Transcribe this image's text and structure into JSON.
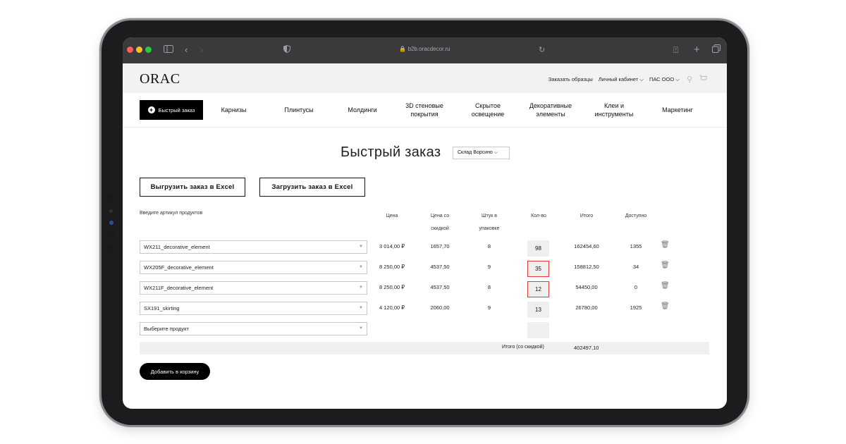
{
  "browser": {
    "url": "b2b.oracdecor.ru",
    "traffic_colors": [
      "#ff5f57",
      "#febc2e",
      "#28c840"
    ]
  },
  "site": {
    "logo": "ORAC",
    "top_links": {
      "samples": "Заказать образцы",
      "account": "Личный кабинет ⌵",
      "company": "ПАС ООО ⌵"
    }
  },
  "nav": {
    "quick_order": "Быстрый заказ",
    "items": [
      "Карнизы",
      "Плинтусы",
      "Молдинги",
      "3D стеновые\nпокрытия",
      "Скрытое\nосвещение",
      "Декоративные\nэлементы",
      "Клеи и\nинструменты",
      "Маркетинг"
    ]
  },
  "main": {
    "title": "Быстрый заказ",
    "warehouse": "Склад Ворсино ⌵",
    "export_button": "Выгрузить заказ в Excel",
    "import_button": "Загрузить заказ в Excel",
    "columns": {
      "article": "Введите артикул продуктов",
      "price": "Цена",
      "discount_price": "Цена со\nскидкой",
      "per_pack": "Штук в\nупаковке",
      "qty": "Кол-во",
      "total": "Итого",
      "available": "Доступно"
    },
    "rows": [
      {
        "product": "WX211_decorative_element",
        "price": "3 014,00 ₽",
        "discount_price": "1657,70",
        "per_pack": "8",
        "qty": "98",
        "total": "162454,60",
        "available": "1355",
        "error": false
      },
      {
        "product": "WX205F_decorative_element",
        "price": "8 250,00 ₽",
        "discount_price": "4537,50",
        "per_pack": "9",
        "qty": "35",
        "total": "158812,50",
        "available": "34",
        "error": true
      },
      {
        "product": "WX211F_decorative_element",
        "price": "8 250,00 ₽",
        "discount_price": "4537,50",
        "per_pack": "8",
        "qty": "12",
        "total": "54450,00",
        "available": "0",
        "error": true
      },
      {
        "product": "SX191_skirting",
        "price": "4 120,00 ₽",
        "discount_price": "2060,00",
        "per_pack": "9",
        "qty": "13",
        "total": "26780,00",
        "available": "1925",
        "error": false
      }
    ],
    "empty_row_placeholder": "Выберите продукт",
    "grand_total_label": "Итого (со скидкой)",
    "grand_total_value": "402497,10",
    "add_to_cart": "Добавить в корзину"
  }
}
